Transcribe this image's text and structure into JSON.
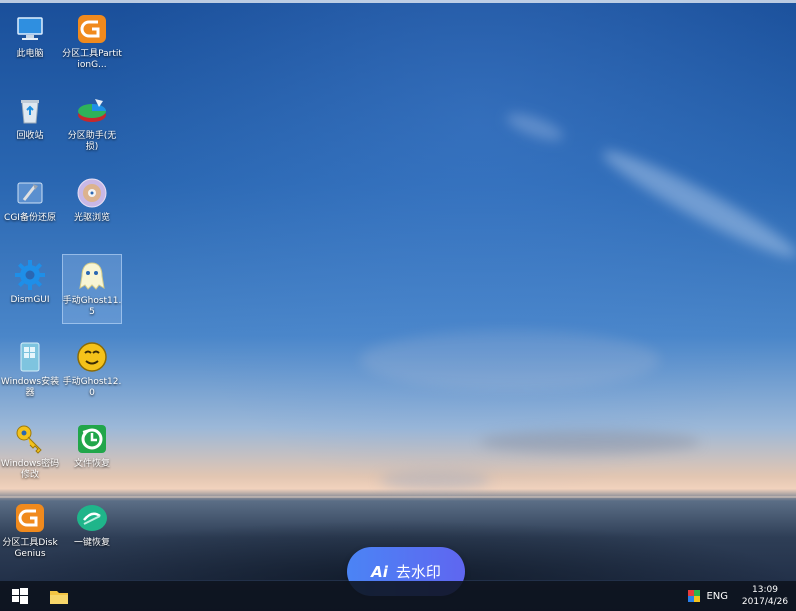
{
  "desktop": {
    "icons": [
      {
        "label": "此电脑",
        "icon": "computer-icon"
      },
      {
        "label": "分区工具PartitionG...",
        "icon": "partition-tool-icon"
      },
      {
        "label": "回收站",
        "icon": "recycle-bin-icon"
      },
      {
        "label": "分区助手(无损)",
        "icon": "partition-assistant-icon"
      },
      {
        "label": "CGI备份还原",
        "icon": "cgi-backup-icon"
      },
      {
        "label": "光驱浏览",
        "icon": "optical-drive-icon"
      },
      {
        "label": "DismGUI",
        "icon": "gear-icon"
      },
      {
        "label": "手动Ghost11.5",
        "icon": "ghost-icon"
      },
      {
        "label": "Windows安装器",
        "icon": "windows-installer-icon"
      },
      {
        "label": "手动Ghost12.0",
        "icon": "ghost12-icon"
      },
      {
        "label": "Windows密码修改",
        "icon": "key-icon"
      },
      {
        "label": "文件恢复",
        "icon": "file-recovery-icon"
      },
      {
        "label": "分区工具DiskGenius",
        "icon": "diskgenius-icon"
      },
      {
        "label": "一键恢复",
        "icon": "one-key-restore-icon"
      }
    ]
  },
  "watermark_button": {
    "ai": "Ai",
    "label": "去水印"
  },
  "taskbar": {
    "language": "ENG",
    "time": "13:09",
    "date": "2017/4/26"
  },
  "colors": {
    "taskbar": "#0c121c",
    "pill_start": "#4b84f5",
    "pill_end": "#5f66f0",
    "selection": "#aac8f0"
  }
}
